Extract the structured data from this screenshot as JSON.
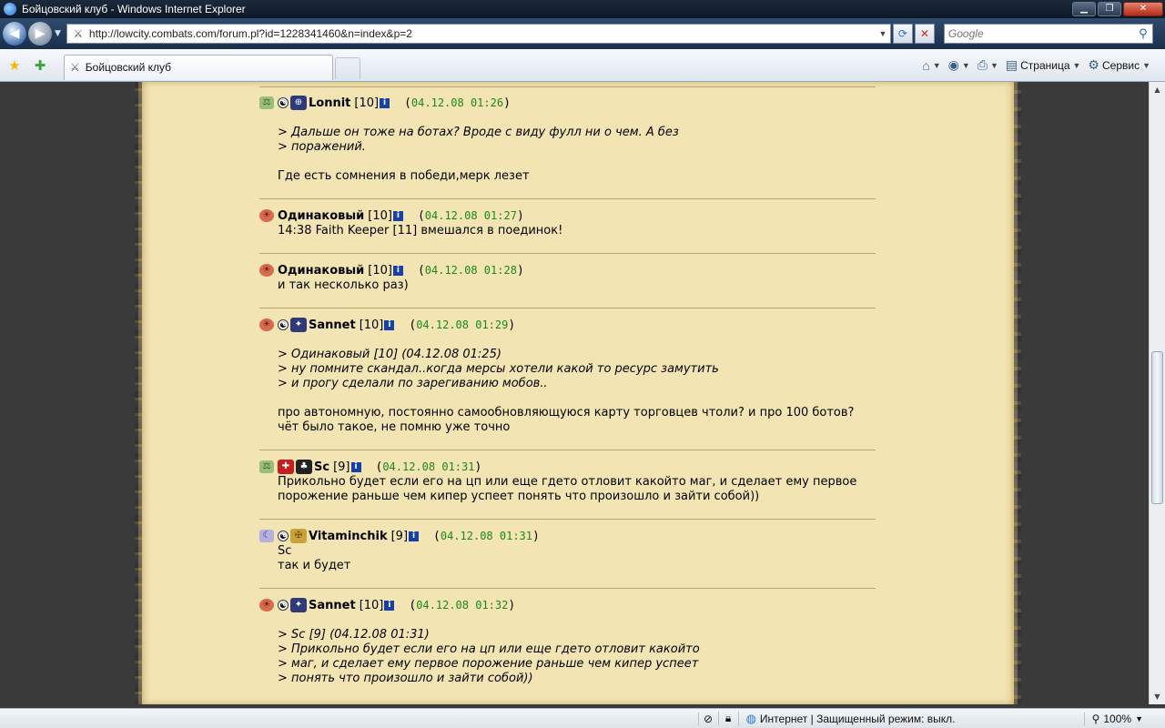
{
  "window": {
    "title": "Бойцовский клуб - Windows Internet Explorer"
  },
  "address": {
    "url": "http://lowcity.combats.com/forum.pl?id=1228341460&n=index&p=2",
    "search_placeholder": "Google"
  },
  "tabs": [
    {
      "label": "Бойцовский клуб"
    }
  ],
  "commands": {
    "page": "Страница",
    "tools": "Сервис"
  },
  "posts": [
    {
      "nick": "Lonnit",
      "level": "[10]",
      "date": "04.12.08 01:26",
      "quote": [
        "> Дальше он тоже на ботах? Вроде с виду фулл ни о чем. А без",
        "> поражений."
      ],
      "text": [
        "Где есть сомнения в победи,мерк лезет"
      ]
    },
    {
      "nick": "Одинаковый",
      "level": "[10]",
      "date": "04.12.08 01:27",
      "quote": [],
      "text": [
        "14:38 Faith Keeper [11] вмешался в поединок!"
      ]
    },
    {
      "nick": "Одинаковый",
      "level": "[10]",
      "date": "04.12.08 01:28",
      "quote": [],
      "text": [
        "и так несколько раз)"
      ]
    },
    {
      "nick": "Sannet",
      "level": "[10]",
      "date": "04.12.08 01:29",
      "quote": [
        "> Одинаковый [10]   (04.12.08 01:25)",
        "> ну помните скандал..когда мерсы хотели какой то ресурс замутить",
        "> и прогу сделали по зарегиванию мобов.."
      ],
      "text": [
        "про автономную, постоянно самообновляющуюся карту торговцев чтоли? и про 100 ботов?",
        "чёт было такое, не помню уже точно"
      ]
    },
    {
      "nick": "Sc",
      "level": "[9]",
      "date": "04.12.08 01:31",
      "quote": [],
      "text": [
        "Прикольно будет если его на цп или еще гдето отловит какойто маг, и сделает ему первое",
        "порожение раньше чем кипер успеет понять что произошло и зайти собой))"
      ]
    },
    {
      "nick": "Vitaminchik",
      "level": "[9]",
      "date": "04.12.08 01:31",
      "quote": [],
      "text": [
        "Sc",
        "так и будет"
      ]
    },
    {
      "nick": "Sannet",
      "level": "[10]",
      "date": "04.12.08 01:32",
      "quote": [
        "> Sc [9]   (04.12.08 01:31)",
        "> Прикольно будет если его на цп или еще гдето отловит какойто",
        "> маг, и сделает ему первое порожение раньше чем кипер успеет",
        "> понять что произошло и зайти собой))"
      ],
      "text": []
    }
  ],
  "status": {
    "zone": "Интернет | Защищенный режим: выкл.",
    "zoom": "100%"
  }
}
